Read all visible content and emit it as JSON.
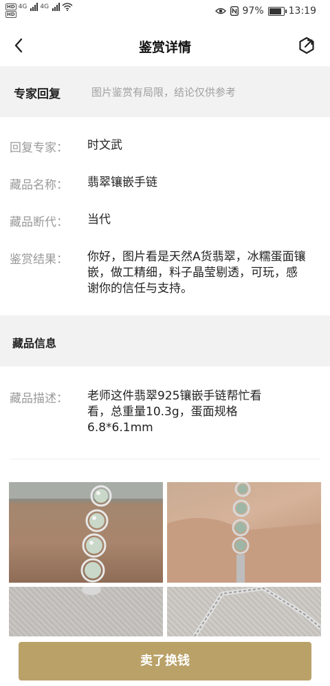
{
  "status": {
    "network": "4G",
    "network2": "4G",
    "battery": "97%",
    "time": "13:19"
  },
  "header": {
    "title": "鉴赏详情"
  },
  "expert_section": {
    "title": "专家回复",
    "note": "图片鉴赏有局限，结论仅供参考"
  },
  "details": {
    "expert_label": "回复专家：",
    "expert_value": "时文武",
    "name_label": "藏品名称：",
    "name_value": "翡翠镶嵌手链",
    "era_label": "藏品断代：",
    "era_value": "当代",
    "result_label": "鉴赏结果：",
    "result_value": "你好，图片看是天然A货翡翠，冰糯蛋面镶嵌，做工精细，料子晶莹剔透，可玩，感谢你的信任与支持。"
  },
  "collection_section": {
    "title": "藏品信息"
  },
  "description": {
    "label": "藏品描述：",
    "value": "老师这件翡翠925镶嵌手链帮忙看看，总重量10.3g，蛋面规格6.8*6.1mm"
  },
  "bottom_button": {
    "label": "卖了换钱"
  }
}
